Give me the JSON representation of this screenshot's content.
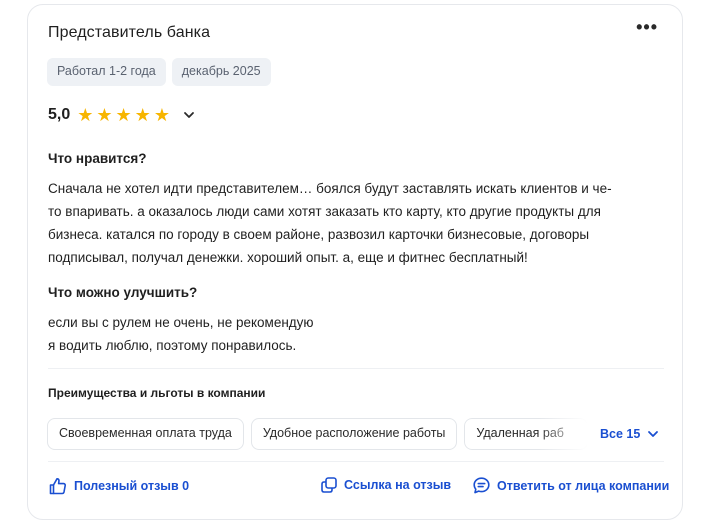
{
  "review": {
    "title": "Представитель банка",
    "more_label": "•••",
    "tags": [
      "Работал 1-2 года",
      "декабрь 2025"
    ],
    "rating_value": "5,0",
    "rating_stars": 5,
    "likes_heading": "Что нравится?",
    "likes_lines": [
      "Сначала не хотел идти представителем… боялся будут заставлять искать клиентов и че-",
      "то впаривать. а оказалось люди сами хотят заказать кто карту, кто другие продукты для",
      "бизнеса. катался по городу в своем районе, развозил карточки бизнесовые, договоры",
      "подписывал, получал денежки. хороший опыт. а, еще и фитнес бесплатный!"
    ],
    "improve_heading": "Что можно улучшить?",
    "improve_lines": [
      "если вы с рулем не очень, не рекомендую",
      "я водить люблю, поэтому понравилось."
    ]
  },
  "benefits": {
    "heading": "Преимущества и льготы в компании",
    "chips": [
      "Своевременная оплата труда",
      "Удобное расположение работы",
      "Удаленная раб"
    ],
    "all_label": "Все 15"
  },
  "footer": {
    "helpful_label": "Полезный отзыв 0",
    "link_label": "Ссылка на отзыв",
    "reply_label": "Ответить от лица компании"
  },
  "colors": {
    "accent": "#1a4fd1",
    "star": "#f7b500",
    "tag_bg": "#eef1f5"
  }
}
